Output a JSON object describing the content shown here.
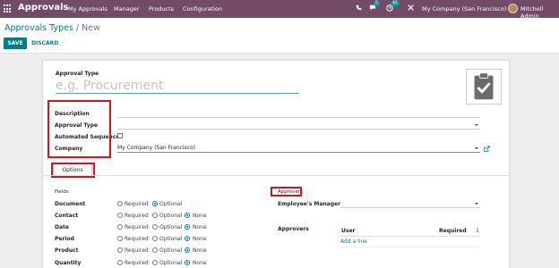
{
  "navbar": {
    "brand": "Approvals",
    "menu": [
      "My Approvals",
      "Manager",
      "Products",
      "Configuration"
    ],
    "chat_badge": "5",
    "activity_badge": "42",
    "company": "My Company (San Francisco)",
    "user": "Mitchell Admin",
    "colors": {
      "bar": "#714b67",
      "badge": "#00a09d"
    }
  },
  "control": {
    "breadcrumb_link": "Approvals Types",
    "breadcrumb_sep": "/",
    "breadcrumb_current": "New",
    "save_label": "SAVE",
    "discard_label": "DISCARD"
  },
  "form": {
    "approval_type_label": "Approval Type",
    "name_placeholder": "e.g. Procurement",
    "description_label": "Description",
    "approval_type_field_label": "Approval Type",
    "automated_sequence_label": "Automated Sequence?",
    "company_label": "Company",
    "company_value": "My Company (San Francisco)",
    "image_icon": "clipboard-check-icon"
  },
  "tabs": {
    "options_label": "Options"
  },
  "fields_group": {
    "title": "Fields",
    "options": [
      "Required",
      "Optional",
      "None"
    ],
    "rows": [
      {
        "label": "Document",
        "selected": "Optional",
        "has_none": false
      },
      {
        "label": "Contact",
        "selected": "None",
        "has_none": true
      },
      {
        "label": "Date",
        "selected": "None",
        "has_none": true
      },
      {
        "label": "Period",
        "selected": "None",
        "has_none": true
      },
      {
        "label": "Product",
        "selected": "None",
        "has_none": true
      },
      {
        "label": "Quantity",
        "selected": "None",
        "has_none": true
      }
    ]
  },
  "approvers_group": {
    "title": "Approvers",
    "employees_manager_label": "Employee's Manager",
    "approvers_label": "Approvers",
    "columns": [
      "User",
      "Required"
    ],
    "add_line": "Add a line"
  },
  "accent": "#017e84",
  "highlight": "#e0101a"
}
